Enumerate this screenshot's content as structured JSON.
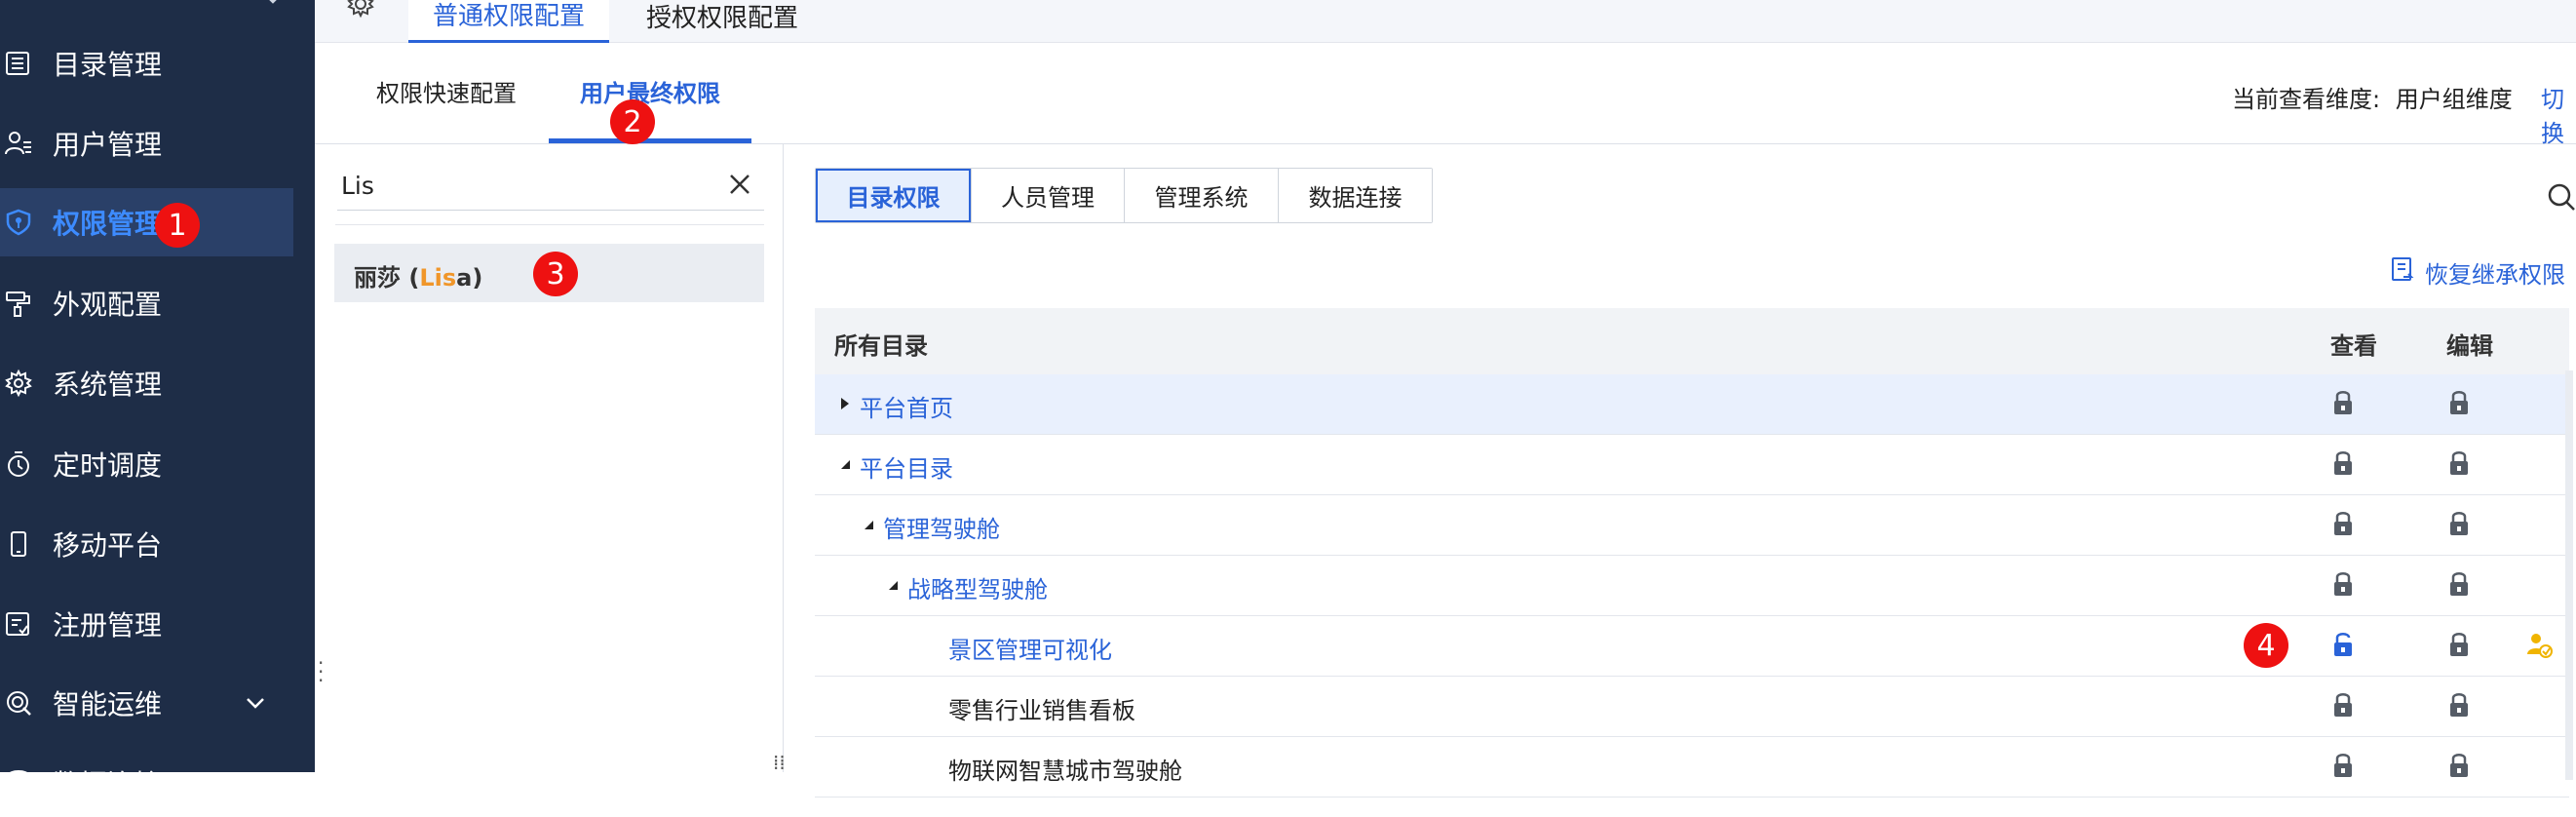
{
  "sidebar": {
    "items": [
      {
        "label": "目录管理",
        "icon": "list-icon"
      },
      {
        "label": "用户管理",
        "icon": "user-list-icon"
      },
      {
        "label": "权限管理",
        "icon": "shield-icon",
        "active": true
      },
      {
        "label": "外观配置",
        "icon": "paint-roller-icon"
      },
      {
        "label": "系统管理",
        "icon": "gear-icon"
      },
      {
        "label": "定时调度",
        "icon": "timer-icon"
      },
      {
        "label": "移动平台",
        "icon": "mobile-icon"
      },
      {
        "label": "注册管理",
        "icon": "register-icon"
      },
      {
        "label": "智能运维",
        "icon": "ops-icon",
        "expandable": true
      },
      {
        "label": "数据连接",
        "icon": "database-icon"
      }
    ]
  },
  "top_tabs": {
    "items": [
      {
        "label": "普通权限配置",
        "active": true
      },
      {
        "label": "授权权限配置"
      }
    ]
  },
  "sub_tabs": {
    "items": [
      {
        "label": "权限快速配置"
      },
      {
        "label": "用户最终权限",
        "active": true
      }
    ],
    "dimension_label": "当前查看维度:",
    "dimension_value": "用户组维度",
    "switch_label": "切换"
  },
  "user_search": {
    "value": "Lis",
    "results": [
      {
        "prefix": "丽莎 (",
        "highlight": "Lis",
        "suffix": "a)"
      }
    ]
  },
  "category_tabs": [
    "目录权限",
    "人员管理",
    "管理系统",
    "数据连接"
  ],
  "restore_label": "恢复继承权限",
  "table": {
    "header": {
      "name": "所有目录",
      "view": "查看",
      "edit": "编辑"
    },
    "rows": [
      {
        "name": "平台首页",
        "caret": "right",
        "link": true,
        "selected": true,
        "view": "locked",
        "edit": "locked"
      },
      {
        "name": "平台目录",
        "caret": "down",
        "link": true,
        "view": "locked",
        "edit": "locked"
      },
      {
        "name": "管理驾驶舱",
        "caret": "down",
        "link": true,
        "view": "locked",
        "edit": "locked"
      },
      {
        "name": "战略型驾驶舱",
        "caret": "down",
        "link": true,
        "view": "locked",
        "edit": "locked"
      },
      {
        "name": "景区管理可视化",
        "caret": "",
        "link": true,
        "view": "unlocked",
        "edit": "locked",
        "extra_icon": "user-permission-icon"
      },
      {
        "name": "零售行业销售看板",
        "caret": "",
        "link": false,
        "view": "locked",
        "edit": "locked"
      },
      {
        "name": "物联网智慧城市驾驶舱",
        "caret": "",
        "link": false,
        "view": "locked",
        "edit": "locked"
      }
    ]
  },
  "callouts": [
    "1",
    "2",
    "3",
    "4"
  ],
  "colors": {
    "sidebar_bg": "#1e2d47",
    "accent": "#2a63d8",
    "callout": "#ee1111",
    "highlight": "#f0962a"
  }
}
